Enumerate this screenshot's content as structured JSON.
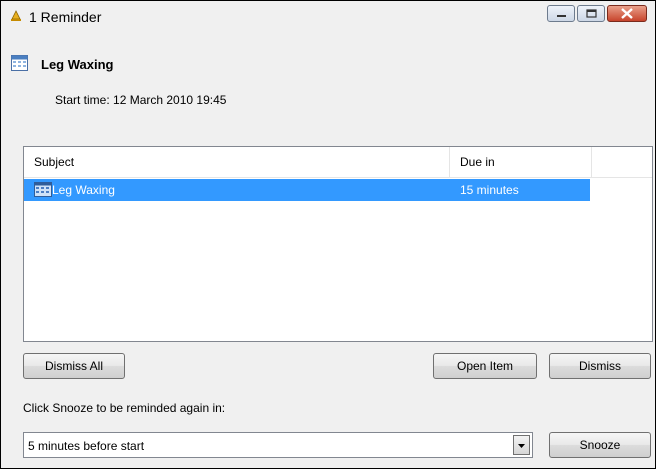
{
  "window": {
    "title": "1 Reminder"
  },
  "header": {
    "item_title": "Leg Waxing",
    "start_time": "Start time: 12 March 2010 19:45"
  },
  "list": {
    "columns": [
      "Subject",
      "Due in"
    ],
    "rows": [
      {
        "subject": "Leg Waxing",
        "due": "15 minutes",
        "selected": true
      }
    ]
  },
  "buttons": {
    "dismiss_all": "Dismiss All",
    "open_item": "Open Item",
    "dismiss": "Dismiss",
    "snooze": "Snooze"
  },
  "snooze": {
    "label": "Click Snooze to be reminded again in:",
    "selected": "5 minutes before start"
  },
  "icons": {
    "title": "reminder-bell-icon",
    "item": "calendar-icon",
    "row": "calendar-icon",
    "minimize": "minimize-icon",
    "maximize": "maximize-icon",
    "close": "close-icon",
    "dropdown": "chevron-down-icon"
  },
  "colors": {
    "selection": "#3399ff",
    "close_button": "#c7442c",
    "window_bg": "#f0f0f0"
  }
}
